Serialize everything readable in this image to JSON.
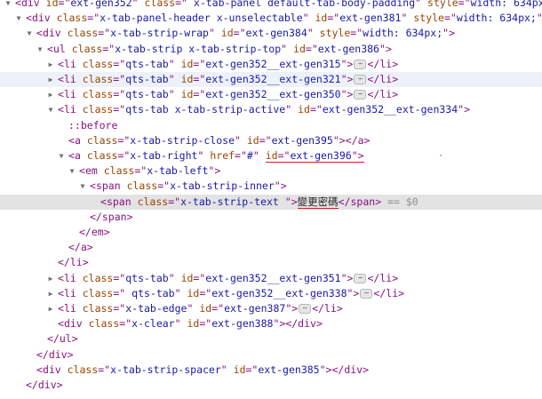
{
  "dom_tree": {
    "comment_suffix": " == $0",
    "ellipsis_glyph": "⋯",
    "nodes": [
      {
        "kind": "open",
        "depth": 0,
        "arrow": "▼",
        "tag": "div",
        "attrs": [
          {
            "n": "id",
            "v": "ext-gen352"
          },
          {
            "n": "class",
            "v": " x-tab-panel default-tab-body-padding"
          },
          {
            "n": "style",
            "v": "width: 634px;"
          }
        ],
        "close": ">"
      },
      {
        "kind": "open",
        "depth": 1,
        "arrow": "▼",
        "tag": "div",
        "attrs": [
          {
            "n": "class",
            "v": "x-tab-panel-header x-unselectable"
          },
          {
            "n": "id",
            "v": "ext-gen381"
          },
          {
            "n": "style",
            "v": "width: 634px;"
          }
        ],
        "close": ">"
      },
      {
        "kind": "open",
        "depth": 2,
        "arrow": "▼",
        "tag": "div",
        "attrs": [
          {
            "n": "class",
            "v": "x-tab-strip-wrap"
          },
          {
            "n": "id",
            "v": "ext-gen384"
          },
          {
            "n": "style",
            "v": "width: 634px;"
          }
        ],
        "close": ">"
      },
      {
        "kind": "open",
        "depth": 3,
        "arrow": "▼",
        "tag": "ul",
        "attrs": [
          {
            "n": "class",
            "v": "x-tab-strip x-tab-strip-top"
          },
          {
            "n": "id",
            "v": "ext-gen386"
          }
        ],
        "close": ">"
      },
      {
        "kind": "collapsed",
        "depth": 4,
        "arrow": "▶",
        "tag": "li",
        "attrs": [
          {
            "n": "class",
            "v": "qts-tab"
          },
          {
            "n": "id",
            "v": "ext-gen352__ext-gen315"
          }
        ]
      },
      {
        "kind": "collapsed",
        "depth": 4,
        "arrow": "▶",
        "tag": "li",
        "attrs": [
          {
            "n": "class",
            "v": "qts-tab"
          },
          {
            "n": "id",
            "v": "ext-gen352__ext-gen321"
          }
        ],
        "hover": true
      },
      {
        "kind": "collapsed",
        "depth": 4,
        "arrow": "▶",
        "tag": "li",
        "attrs": [
          {
            "n": "class",
            "v": "qts-tab"
          },
          {
            "n": "id",
            "v": "ext-gen352__ext-gen350"
          }
        ]
      },
      {
        "kind": "open",
        "depth": 4,
        "arrow": "▼",
        "tag": "li",
        "attrs": [
          {
            "n": "class",
            "v": "qts-tab x-tab-strip-active"
          },
          {
            "n": "id",
            "v": "ext-gen352__ext-gen334"
          }
        ],
        "close": ">"
      },
      {
        "kind": "pseudo",
        "depth": 5,
        "text": "::before"
      },
      {
        "kind": "leaf",
        "depth": 5,
        "tag": "a",
        "attrs": [
          {
            "n": "class",
            "v": "x-tab-strip-close"
          },
          {
            "n": "id",
            "v": "ext-gen395"
          }
        ]
      },
      {
        "kind": "open",
        "depth": 5,
        "arrow": "▼",
        "tag": "a",
        "attrs": [
          {
            "n": "class",
            "v": "x-tab-right"
          },
          {
            "n": "href",
            "v": "#"
          },
          {
            "n": "id",
            "v": "ext-gen396",
            "underline": true
          }
        ],
        "close": ">",
        "close_underline": true
      },
      {
        "kind": "open",
        "depth": 6,
        "arrow": "▼",
        "tag": "em",
        "attrs": [
          {
            "n": "class",
            "v": "x-tab-left"
          }
        ],
        "close": ">"
      },
      {
        "kind": "open",
        "depth": 7,
        "arrow": "▼",
        "tag": "span",
        "attrs": [
          {
            "n": "class",
            "v": "x-tab-strip-inner"
          }
        ],
        "close": ">"
      },
      {
        "kind": "textnode",
        "depth": 8,
        "tag": "span",
        "attrs": [
          {
            "n": "class",
            "v": "x-tab-strip-text "
          }
        ],
        "text": "變更密碼",
        "selected": true
      },
      {
        "kind": "closetag",
        "depth": 7,
        "tag": "span"
      },
      {
        "kind": "closetag",
        "depth": 6,
        "tag": "em"
      },
      {
        "kind": "closetag",
        "depth": 5,
        "tag": "a"
      },
      {
        "kind": "closetag",
        "depth": 4,
        "tag": "li"
      },
      {
        "kind": "collapsed",
        "depth": 4,
        "arrow": "▶",
        "tag": "li",
        "attrs": [
          {
            "n": "class",
            "v": "qts-tab"
          },
          {
            "n": "id",
            "v": "ext-gen352__ext-gen351"
          }
        ]
      },
      {
        "kind": "collapsed",
        "depth": 4,
        "arrow": "▶",
        "tag": "li",
        "attrs": [
          {
            "n": "class",
            "v": " qts-tab"
          },
          {
            "n": "id",
            "v": "ext-gen352__ext-gen338"
          }
        ]
      },
      {
        "kind": "collapsed",
        "depth": 4,
        "arrow": "▶",
        "tag": "li",
        "attrs": [
          {
            "n": "class",
            "v": "x-tab-edge"
          },
          {
            "n": "id",
            "v": "ext-gen387"
          }
        ]
      },
      {
        "kind": "leaf",
        "depth": 4,
        "tag": "div",
        "attrs": [
          {
            "n": "class",
            "v": "x-clear"
          },
          {
            "n": "id",
            "v": "ext-gen388"
          }
        ]
      },
      {
        "kind": "closetag",
        "depth": 3,
        "tag": "ul"
      },
      {
        "kind": "closetag",
        "depth": 2,
        "tag": "div"
      },
      {
        "kind": "leaf",
        "depth": 2,
        "tag": "div",
        "attrs": [
          {
            "n": "class",
            "v": "x-tab-strip-spacer"
          },
          {
            "n": "id",
            "v": "ext-gen385"
          }
        ]
      },
      {
        "kind": "closetag",
        "depth": 1,
        "tag": "div"
      }
    ]
  }
}
